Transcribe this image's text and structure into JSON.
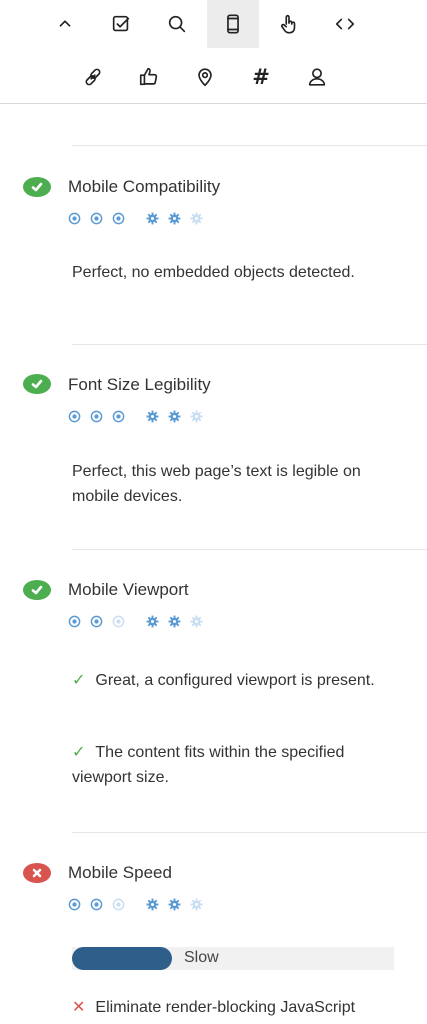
{
  "toolbar": {
    "row1": [
      "chevron-up-icon",
      "checkbox-icon",
      "search-icon",
      "mobile-icon",
      "hand-pointer-icon",
      "code-icon"
    ],
    "row2": [
      "link-icon",
      "thumbs-up-icon",
      "map-pin-icon",
      "hash-icon",
      "user-icon"
    ],
    "active": "mobile-icon",
    "hash_glyph": "#"
  },
  "colors": {
    "pass": "#4cae4f",
    "fail": "#d9534f",
    "rating_active": "#5b9bd5",
    "rating_inactive": "#c9def3",
    "speed_bar": "#2e5f8a"
  },
  "sections": [
    {
      "title": "Mobile Compatibility",
      "status": "pass",
      "rating_dots": [
        true,
        true,
        true
      ],
      "rating_gears": [
        true,
        true,
        false
      ],
      "message": "Perfect, no embedded objects detected."
    },
    {
      "title": "Font Size Legibility",
      "status": "pass",
      "rating_dots": [
        true,
        true,
        true
      ],
      "rating_gears": [
        true,
        true,
        false
      ],
      "message": "Perfect, this web page’s text is legible on mobile devices."
    },
    {
      "title": "Mobile Viewport",
      "status": "pass",
      "rating_dots": [
        true,
        true,
        false
      ],
      "rating_gears": [
        true,
        true,
        false
      ],
      "checks": [
        "Great, a configured viewport is present.",
        "The content fits within the specified viewport size."
      ]
    },
    {
      "title": "Mobile Speed",
      "status": "fail",
      "rating_dots": [
        true,
        true,
        false
      ],
      "rating_gears": [
        true,
        true,
        false
      ],
      "speed_label": "Slow",
      "speed_fraction": 0.31,
      "issues": [
        "Eliminate render-blocking JavaScript"
      ]
    }
  ]
}
